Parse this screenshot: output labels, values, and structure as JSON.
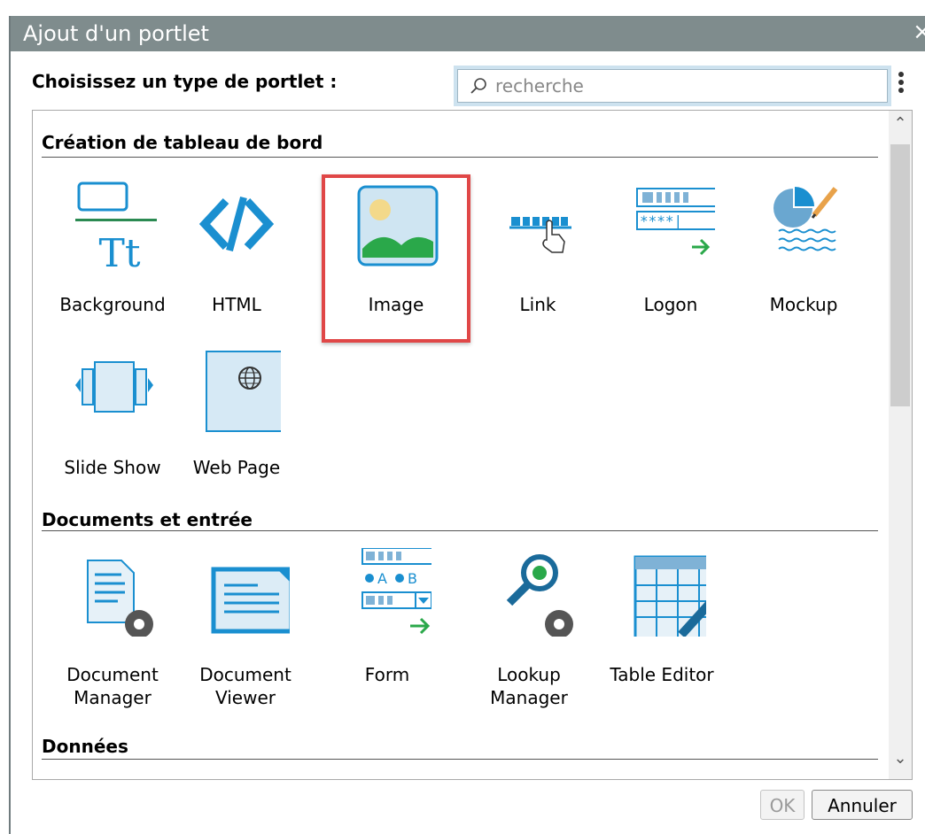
{
  "dialog": {
    "title": "Ajout d'un portlet",
    "close_glyph": "×",
    "prompt": "Choisissez un type de portlet :",
    "search": {
      "placeholder": "recherche",
      "value": ""
    },
    "ok_label": "OK",
    "cancel_label": "Annuler"
  },
  "sections": [
    {
      "title": "Création de tableau de bord",
      "items": [
        {
          "label": "Background",
          "icon": "background-icon"
        },
        {
          "label": "HTML",
          "icon": "html-code-icon"
        },
        {
          "label": "Image",
          "icon": "image-icon",
          "selected": true
        },
        {
          "label": "Link",
          "icon": "link-icon"
        },
        {
          "label": "Logon",
          "icon": "logon-icon"
        },
        {
          "label": "Mockup",
          "icon": "mockup-icon"
        },
        {
          "label": "Slide Show",
          "icon": "slideshow-icon"
        },
        {
          "label": "Web Page",
          "icon": "globe-icon"
        }
      ]
    },
    {
      "title": "Documents et entrée",
      "items": [
        {
          "label": "Document\nManager",
          "icon": "document-manager-icon"
        },
        {
          "label": "Document\nViewer",
          "icon": "document-viewer-icon"
        },
        {
          "label": "Form",
          "icon": "form-icon"
        },
        {
          "label": "Lookup\nManager",
          "icon": "lookup-manager-icon"
        },
        {
          "label": "Table Editor",
          "icon": "table-editor-icon"
        }
      ]
    },
    {
      "title": "Données",
      "items": []
    }
  ],
  "colors": {
    "titlebar": "#7f8c8d",
    "accent_blue": "#1a8fd0",
    "green": "#2aa84a",
    "highlight": "#e04747"
  }
}
